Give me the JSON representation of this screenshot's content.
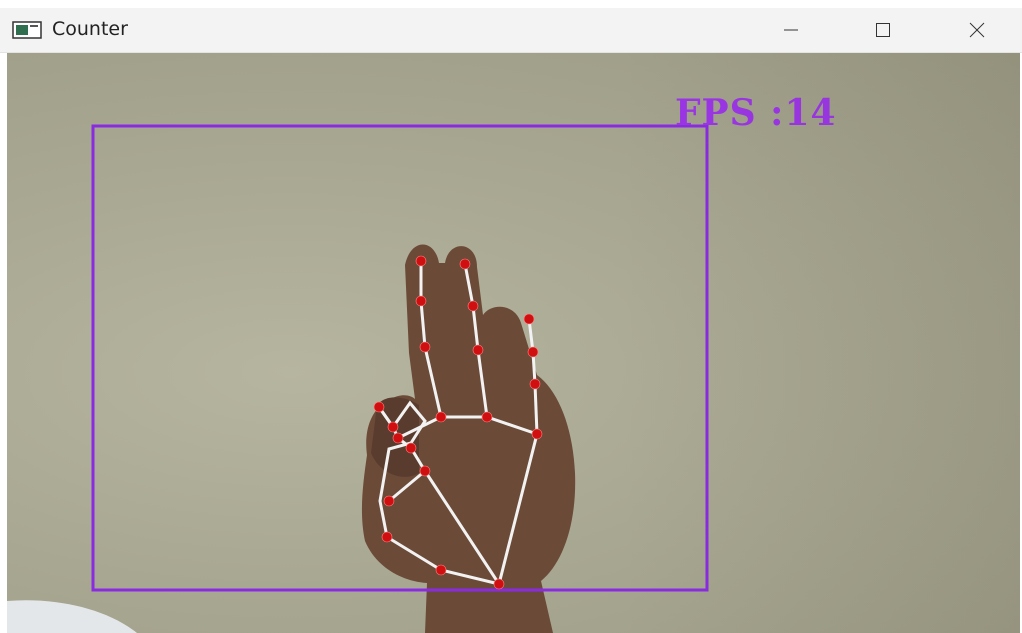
{
  "window": {
    "title": "Counter",
    "controls": {
      "minimize": "minimize",
      "maximize": "maximize",
      "close": "close"
    }
  },
  "overlay": {
    "fps_text": "FPS :14",
    "box_color": "#8a2be2",
    "skeleton_color": "#f2f2f2",
    "landmark_color": "#d01010"
  },
  "icons": [
    "app-window-icon",
    "minimize-icon",
    "maximize-icon",
    "close-icon"
  ]
}
